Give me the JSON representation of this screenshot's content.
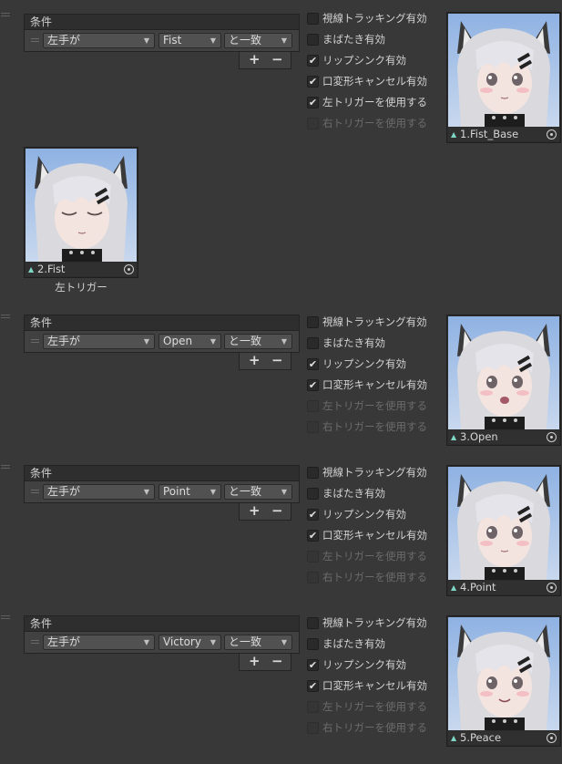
{
  "labels": {
    "conditions": "条件",
    "plus": "+",
    "minus": "−",
    "left_trigger_caption": "左トリガー"
  },
  "toggle_labels": [
    "視線トラッキング有効",
    "まばたき有効",
    "リップシンク有効",
    "口変形キャンセル有効",
    "左トリガーを使用する",
    "右トリガーを使用する"
  ],
  "blocks": [
    {
      "condition": {
        "param": "左手が",
        "value": "Fist",
        "op": "と一致"
      },
      "toggles": [
        {
          "checked": false,
          "enabled": true
        },
        {
          "checked": false,
          "enabled": true
        },
        {
          "checked": true,
          "enabled": true
        },
        {
          "checked": true,
          "enabled": true
        },
        {
          "checked": true,
          "enabled": true
        },
        {
          "checked": false,
          "enabled": false
        }
      ],
      "thumbnail": {
        "name": "1.Fist_Base",
        "expression": "neutral"
      }
    },
    {
      "condition": {
        "param": "左手が",
        "value": "Open",
        "op": "と一致"
      },
      "toggles": [
        {
          "checked": false,
          "enabled": true
        },
        {
          "checked": false,
          "enabled": true
        },
        {
          "checked": true,
          "enabled": true
        },
        {
          "checked": true,
          "enabled": true
        },
        {
          "checked": false,
          "enabled": false
        },
        {
          "checked": false,
          "enabled": false
        }
      ],
      "thumbnail": {
        "name": "3.Open",
        "expression": "open-mouth"
      }
    },
    {
      "condition": {
        "param": "左手が",
        "value": "Point",
        "op": "と一致"
      },
      "toggles": [
        {
          "checked": false,
          "enabled": true
        },
        {
          "checked": false,
          "enabled": true
        },
        {
          "checked": true,
          "enabled": true
        },
        {
          "checked": true,
          "enabled": true
        },
        {
          "checked": false,
          "enabled": false
        },
        {
          "checked": false,
          "enabled": false
        }
      ],
      "thumbnail": {
        "name": "4.Point",
        "expression": "neutral"
      }
    },
    {
      "condition": {
        "param": "左手が",
        "value": "Victory",
        "op": "と一致"
      },
      "toggles": [
        {
          "checked": false,
          "enabled": true
        },
        {
          "checked": false,
          "enabled": true
        },
        {
          "checked": true,
          "enabled": true
        },
        {
          "checked": true,
          "enabled": true
        },
        {
          "checked": false,
          "enabled": false
        },
        {
          "checked": false,
          "enabled": false
        }
      ],
      "thumbnail": {
        "name": "5.Peace",
        "expression": "smile"
      }
    }
  ],
  "left_trigger_thumbnail": {
    "name": "2.Fist",
    "expression": "closed-eyes"
  },
  "colors": {
    "background": "#383838",
    "accent_icon": "#7fd6c4",
    "disabled_text": "#6b6b6b"
  },
  "icons": {
    "checkmark": "✔",
    "dropdown": "▼",
    "asset": "▲",
    "target": "object-picker-icon"
  }
}
